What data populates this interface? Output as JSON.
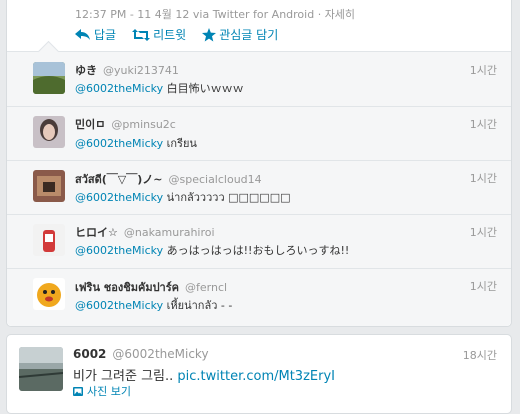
{
  "top_tweet": {
    "meta": "12:37 PM - 11 4월 12 via Twitter for Android · 자세히",
    "actions": {
      "reply": "답글",
      "retweet": "리트윗",
      "favorite": "관심글 담기"
    }
  },
  "replies": [
    {
      "name": "ゆき",
      "handle": "@yuki213741",
      "time": "1시간",
      "mention": "@6002theMicky",
      "text": "白目怖いｗｗｗ"
    },
    {
      "name": "민이ㅁ",
      "handle": "@pminsu2c",
      "time": "1시간",
      "mention": "@6002theMicky",
      "text": "เกรียน"
    },
    {
      "name": "สวัสดี(￣▽￣)ノ~",
      "handle": "@specialcloud14",
      "time": "1시간",
      "mention": "@6002theMicky",
      "text": "น่ากลัววววว □□□□□□"
    },
    {
      "name": "ヒロイ☆",
      "handle": "@nakamurahiroi",
      "time": "1시간",
      "mention": "@6002theMicky",
      "text": "あっはっはっは!!おもしろいっすね!!"
    },
    {
      "name": "เฟริน ชองชิมคัมปาร์ค",
      "handle": "@ferncl",
      "time": "1시간",
      "mention": "@6002theMicky",
      "text": "เหี้ยน่ากลัว - -"
    }
  ],
  "next_tweet": {
    "name": "6002",
    "handle": "@6002theMicky",
    "time": "18시간",
    "text": "비가 그려준 그림..",
    "link": "pic.twitter.com/Mt3zEryI",
    "photo_label": "사진 보기"
  },
  "colors": {
    "link": "#0084b4",
    "muted": "#999999",
    "background": "#e8eaec"
  }
}
